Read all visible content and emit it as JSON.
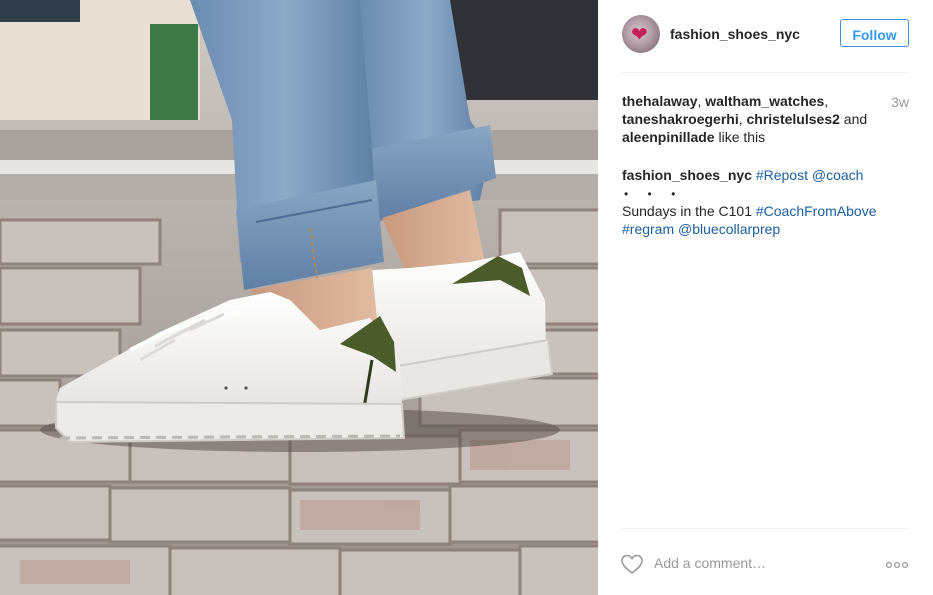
{
  "post": {
    "author": "fashion_shoes_nyc",
    "follow_label": "Follow",
    "time_ago": "3w",
    "likes": {
      "likers": [
        "thehalaway",
        "waltham_watches",
        "taneshakroegerhi",
        "christelulses2",
        "aleenpinillade"
      ],
      "separator": ", ",
      "and_text": " and ",
      "suffix": " like this"
    },
    "caption": {
      "author": "fashion_shoes_nyc",
      "hashtag_repost": "#Repost",
      "mention_coach": "@coach",
      "dots": "• • •",
      "text": "Sundays in the C101 ",
      "hashtag_coachfromabove": "#CoachFromAbove",
      "hashtag_regram": "#regram",
      "mention_bluecollarprep": "@bluecollarprep"
    },
    "comment_placeholder": "Add a comment…"
  },
  "icons": {
    "like": "heart-outline-icon",
    "more": "more-options-icon"
  },
  "colors": {
    "follow_blue": "#3897f0",
    "link_blue": "#1b5e9e",
    "muted_gray": "#999999"
  }
}
